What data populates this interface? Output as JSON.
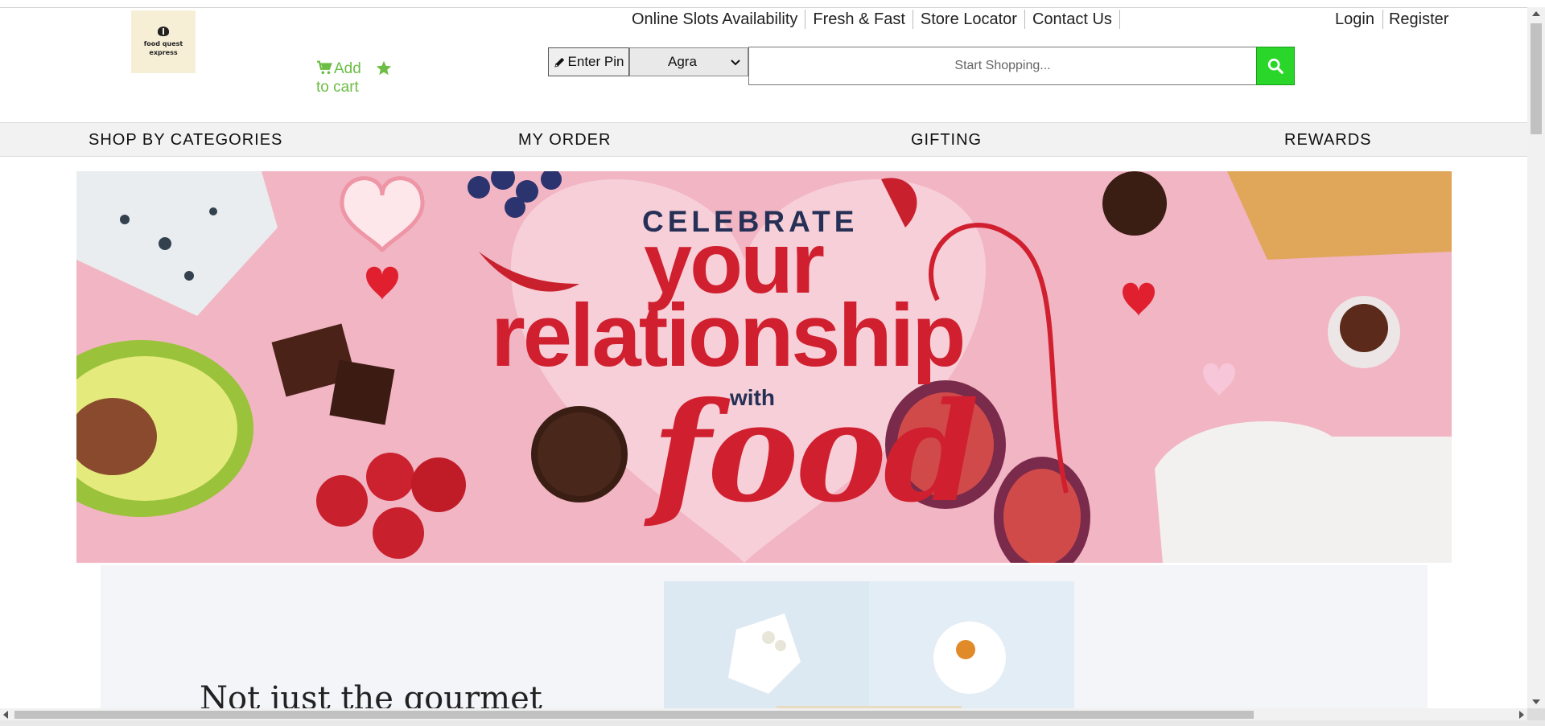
{
  "logo": {
    "line1": "food quest",
    "line2": "express"
  },
  "cart": {
    "label": "Add to cart",
    "color": "#6cbd45"
  },
  "top_links": [
    "Online Slots Availability",
    "Fresh & Fast",
    "Store Locator",
    "Contact Us"
  ],
  "auth": {
    "login": "Login",
    "register": "Register"
  },
  "pin_button": {
    "label": "Enter Pin"
  },
  "city_select": {
    "value": "Agra"
  },
  "search": {
    "placeholder": "Start Shopping...",
    "button_color": "#2ad62a"
  },
  "nav": {
    "items": [
      "SHOP BY CATEGORIES",
      "MY ORDER",
      "GIFTING",
      "REWARDS"
    ]
  },
  "hero": {
    "line1": "CELEBRATE",
    "line2": "your",
    "line3": "relationship",
    "line4": "with",
    "line5": "food",
    "primary_color": "#d0202f",
    "secondary_color": "#263056",
    "background": "#f2b5c3"
  },
  "promo": {
    "heading": "Not just the gourmet"
  }
}
